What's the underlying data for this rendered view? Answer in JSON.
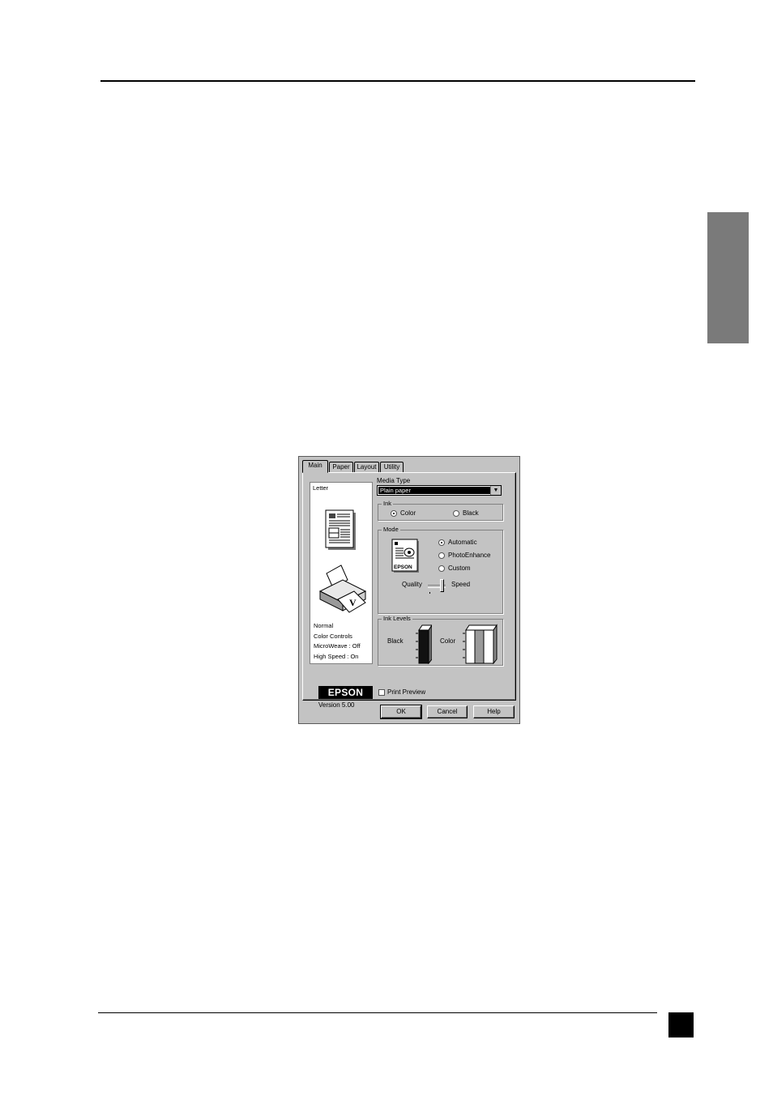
{
  "dialog": {
    "tabs": [
      "Main",
      "Paper",
      "Layout",
      "Utility"
    ],
    "preview_label": "Letter",
    "status_lines": [
      "Normal",
      "Color Controls",
      "MicroWeave : Off",
      "High Speed : On"
    ],
    "media_type": {
      "label": "Media Type",
      "value": "Plain paper"
    },
    "ink": {
      "title": "Ink",
      "options": [
        "Color",
        "Black"
      ],
      "selected": "Color"
    },
    "mode": {
      "title": "Mode",
      "options": [
        "Automatic",
        "PhotoEnhance",
        "Custom"
      ],
      "selected": "Automatic",
      "slider_left": "Quality",
      "slider_right": "Speed",
      "icon_text": "EPSON"
    },
    "ink_levels": {
      "title": "Ink Levels",
      "black_label": "Black",
      "color_label": "Color"
    },
    "logo_text": "EPSON",
    "version": "Version 5.00",
    "print_preview": {
      "label": "Print Preview",
      "checked": false
    },
    "buttons": {
      "ok": "OK",
      "cancel": "Cancel",
      "help": "Help"
    }
  }
}
